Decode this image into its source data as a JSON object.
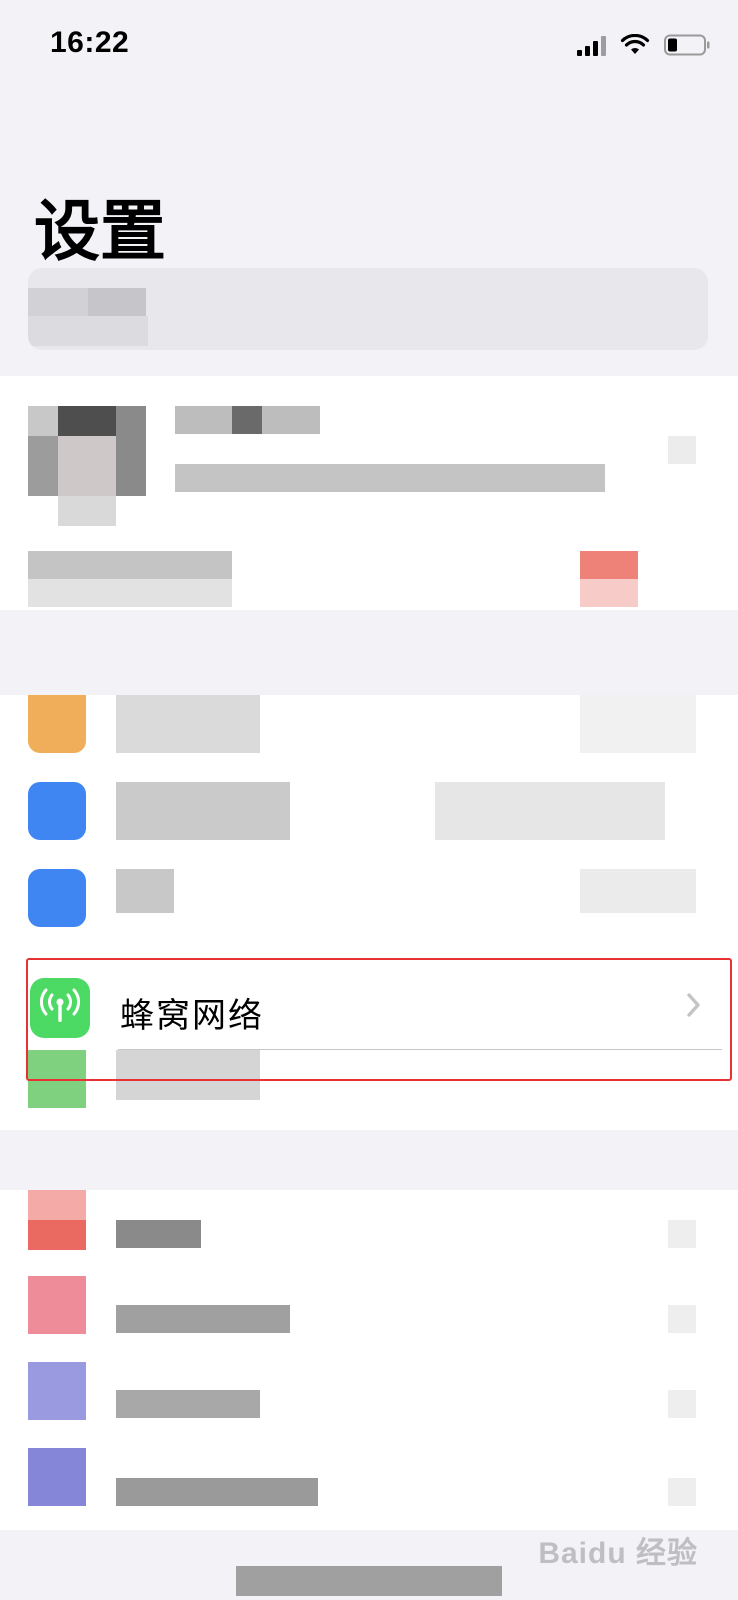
{
  "status_bar": {
    "time": "16:22",
    "signal_icon": "cellular-signal-icon",
    "wifi_icon": "wifi-icon",
    "battery_icon": "battery-icon"
  },
  "page": {
    "title": "设置"
  },
  "rows": {
    "cellular": {
      "label": "蜂窝网络",
      "icon": "antenna-icon",
      "icon_color": "#4cd964",
      "chevron": "chevron-right-icon"
    }
  },
  "highlight_color": "#e63232",
  "watermark": "Baidu 经验"
}
